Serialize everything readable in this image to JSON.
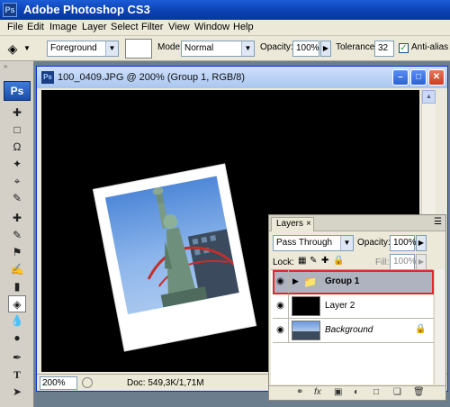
{
  "app": {
    "title": "Adobe Photoshop CS3",
    "logo": "Ps"
  },
  "menu": [
    "File",
    "Edit",
    "Image",
    "Layer",
    "Select",
    "Filter",
    "View",
    "Window",
    "Help"
  ],
  "options": {
    "gradient_mode": "Foreground",
    "mode_label": "Mode:",
    "mode_value": "Normal",
    "opacity_label": "Opacity:",
    "opacity_value": "100%",
    "tolerance_label": "Tolerance:",
    "tolerance_value": "32",
    "antialias_label": "Anti-alias"
  },
  "document": {
    "title": "100_0409.JPG @ 200% (Group 1, RGB/8)",
    "zoom": "200%",
    "doc_info": "Doc: 549,3K/1,71M"
  },
  "layers_panel": {
    "tab": "Layers",
    "blend_mode": "Pass Through",
    "opacity_label": "Opacity:",
    "opacity_value": "100%",
    "lock_label": "Lock:",
    "fill_label": "Fill:",
    "fill_value": "100%",
    "layers": [
      {
        "name": "Group 1",
        "type": "group",
        "selected": true
      },
      {
        "name": "Layer 2",
        "type": "layer",
        "selected": false
      },
      {
        "name": "Background",
        "type": "background",
        "selected": false
      }
    ]
  },
  "colors": {
    "selection_highlight": "#e8242c",
    "title_bar": "#0a3fb0"
  }
}
